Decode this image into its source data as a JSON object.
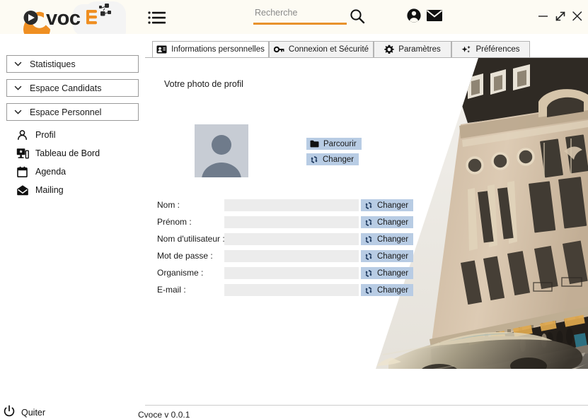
{
  "header": {
    "logo_text": "Cvoce",
    "menu_icon": "list-menu-icon",
    "search": {
      "value": "",
      "placeholder": "Recherche",
      "icon": "search-icon"
    },
    "account_icon": "account-circle-icon",
    "mail_icon": "envelope-icon",
    "window_controls": {
      "minimize": "minimize-icon",
      "maximize": "expand-diagonal-icon",
      "close": "close-icon"
    }
  },
  "sidebar": {
    "sections": [
      {
        "label": "Statistiques",
        "icon": "chevron-down-icon",
        "expanded": false
      },
      {
        "label": "Espace Candidats",
        "icon": "chevron-down-icon",
        "expanded": false
      },
      {
        "label": "Espace Personnel",
        "icon": "chevron-down-icon",
        "expanded": true
      }
    ],
    "items": [
      {
        "label": "Profil",
        "icon": "person-icon"
      },
      {
        "label": "Tableau de Bord",
        "icon": "dashboard-monitor-icon"
      },
      {
        "label": "Agenda",
        "icon": "calendar-icon"
      },
      {
        "label": "Mailing",
        "icon": "mail-envelope-icon"
      }
    ],
    "quit": {
      "label": "Quiter",
      "icon": "power-icon"
    }
  },
  "main": {
    "tabs": [
      {
        "label": "Informations personnelles",
        "icon": "id-card-icon",
        "active": true
      },
      {
        "label": "Connexion et Sécurité",
        "icon": "key-icon",
        "active": false
      },
      {
        "label": "Paramètres",
        "icon": "gear-icon",
        "active": false
      },
      {
        "label": "Préférences",
        "icon": "sparkles-icon",
        "active": false
      }
    ],
    "photo_section": {
      "title": "Votre photo de profil",
      "avatar_icon": "user-placeholder-avatar",
      "browse_button": {
        "label": "Parcourir",
        "icon": "folder-icon"
      },
      "change_button": {
        "label": "Changer",
        "icon": "refresh-sync-icon"
      }
    },
    "fields": [
      {
        "label": "Nom :",
        "value": "",
        "button": "Changer",
        "button_icon": "refresh-sync-icon"
      },
      {
        "label": "Prénom :",
        "value": "",
        "button": "Changer",
        "button_icon": "refresh-sync-icon"
      },
      {
        "label": "Nom d'utilisateur :",
        "value": "",
        "button": "Changer",
        "button_icon": "refresh-sync-icon"
      },
      {
        "label": "Mot de passe :",
        "value": "",
        "button": "Changer",
        "button_icon": "refresh-sync-icon"
      },
      {
        "label": "Organisme :",
        "value": "",
        "button": "Changer",
        "button_icon": "refresh-sync-icon"
      },
      {
        "label": "E-mail :",
        "value": "",
        "button": "Changer",
        "button_icon": "refresh-sync-icon"
      }
    ],
    "decorative_image": "city-street-building-photo"
  },
  "footer": {
    "version": "Cvoce v 0.0.1"
  },
  "colors": {
    "header_bg": "#fdfbf3",
    "accent_orange": "#e8922c",
    "button_blue": "#b8cce4",
    "input_gray": "#ececec",
    "tab_inactive": "#f2f2f2",
    "border_gray": "#b3b3b3"
  }
}
